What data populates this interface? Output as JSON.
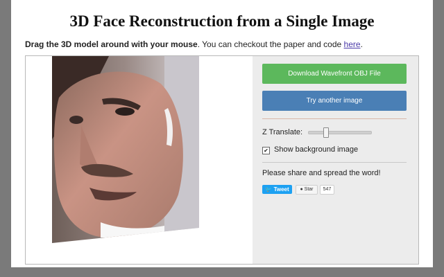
{
  "page": {
    "title": "3D Face Reconstruction from a Single Image",
    "intro_bold": "Drag the 3D model around with your mouse",
    "intro_text": ". You can checkout the paper and code ",
    "intro_link": "here",
    "intro_end": "."
  },
  "controls": {
    "download_label": "Download Wavefront OBJ File",
    "try_label": "Try another image",
    "z_translate_label": "Z Translate:",
    "z_translate_level": 0.25,
    "show_bg_label": "Show background image",
    "show_bg_checked": true,
    "share_text": "Please share and spread the word!",
    "tweet_label": "Tweet",
    "star_label": "Star",
    "star_count": "547"
  },
  "icons": {
    "tweet": "twitter-bird-icon",
    "star": "github-octocat-icon",
    "check": "checkmark-icon"
  },
  "colors": {
    "download_button": "#5cb85c",
    "try_button": "#4a7fb5",
    "tweet_button": "#1da1f2"
  }
}
